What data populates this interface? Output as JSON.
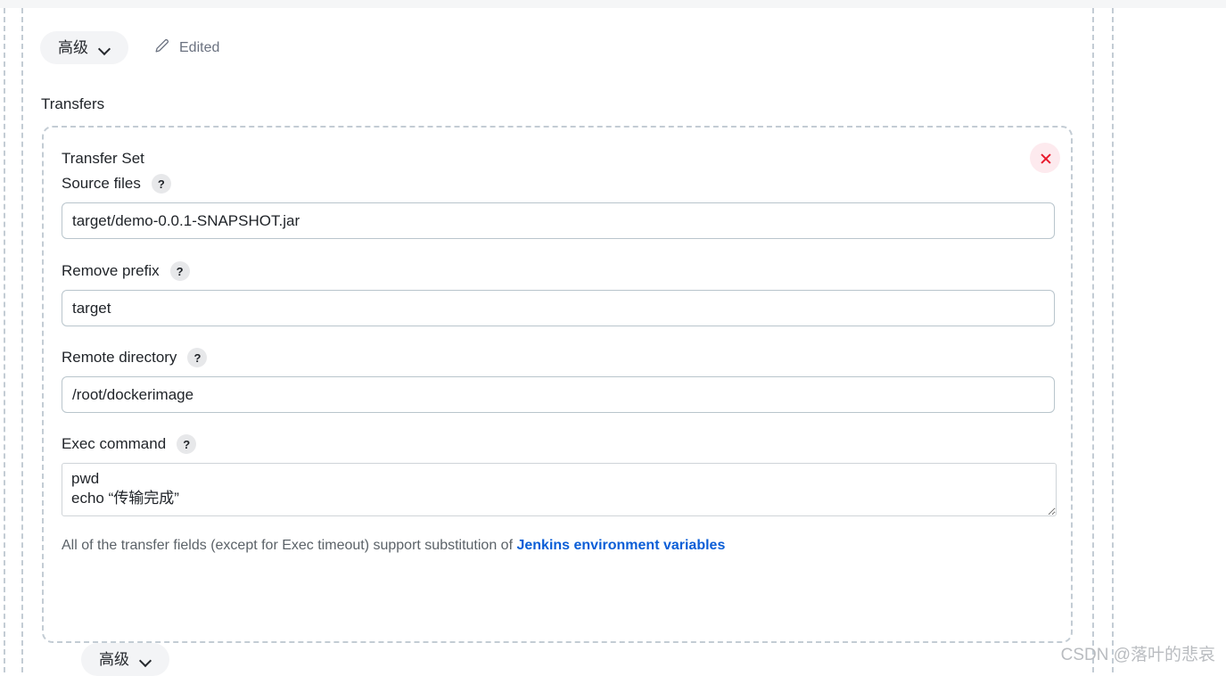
{
  "top": {
    "advanced_button_label": "高级",
    "edited_label": "Edited",
    "transfers_label": "Transfers"
  },
  "transfer_set": {
    "title": "Transfer Set",
    "close_icon": "close-icon",
    "help_badge": "?",
    "fields": [
      {
        "label": "Source files",
        "value": "target/demo-0.0.1-SNAPSHOT.jar",
        "placeholder": ""
      },
      {
        "label": "Remove prefix",
        "value": "target",
        "placeholder": ""
      },
      {
        "label": "Remote directory",
        "value": "/root/dockerimage",
        "placeholder": ""
      }
    ],
    "exec_command": {
      "label": "Exec command",
      "value": "pwd\necho “传输完成”",
      "placeholder": ""
    },
    "hint": {
      "text_before": "All of the transfer fields (except for Exec timeout) support substitution of ",
      "link_text": "Jenkins environment variables"
    }
  },
  "bottom": {
    "advanced_button_label": "高级"
  },
  "watermark": "CSDN @落叶的悲哀",
  "colors": {
    "accent_link": "#0b5ed7",
    "close_red": "#e8192c",
    "dashed_border": "#c3ccd4",
    "input_border": "#b9c5cc"
  }
}
